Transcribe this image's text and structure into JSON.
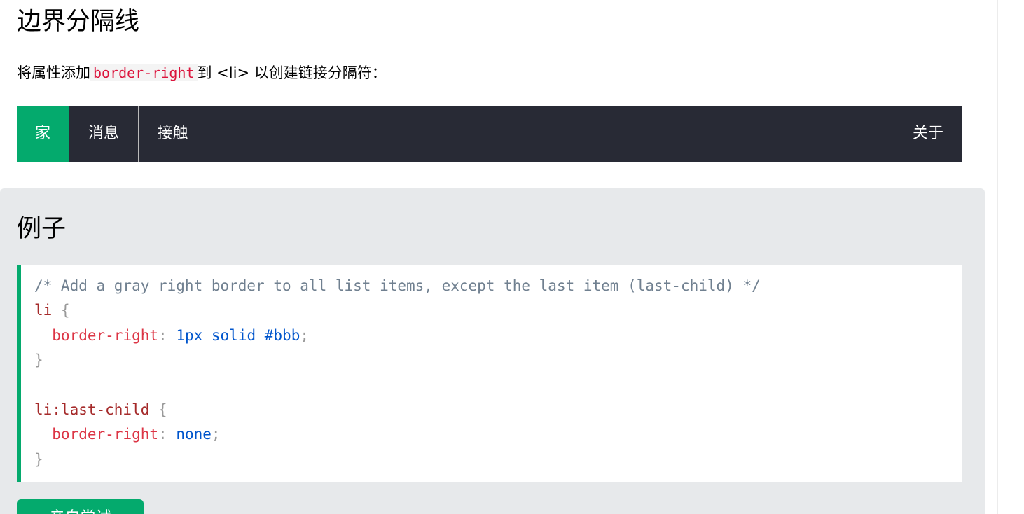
{
  "heading": "边界分隔线",
  "intro": {
    "prefix": "将属性添加",
    "code": "border-right",
    "suffix": "到 <li> 以创建链接分隔符："
  },
  "navbar": {
    "items": [
      {
        "label": "家",
        "active": true
      },
      {
        "label": "消息",
        "active": false
      },
      {
        "label": "接触",
        "active": false
      }
    ],
    "right_item": {
      "label": "关于"
    }
  },
  "example": {
    "title": "例子",
    "code": {
      "comment": "/* Add a gray right border to all list items, except the last item (last-child) */",
      "rule1": {
        "selector": "li",
        "open": "{",
        "property": "border-right",
        "colon": ":",
        "value": "1px solid #bbb",
        "semicolon": ";",
        "close": "}"
      },
      "rule2": {
        "selector": "li:last-child",
        "open": "{",
        "property": "border-right",
        "colon": ":",
        "value": "none",
        "semicolon": ";",
        "close": "}"
      }
    },
    "try_button": "亲自尝试"
  },
  "colors": {
    "accent": "#04aa6d",
    "navbar_bg": "#282a35",
    "separator": "#bbbbbb",
    "example_bg": "#e7e9eb"
  }
}
